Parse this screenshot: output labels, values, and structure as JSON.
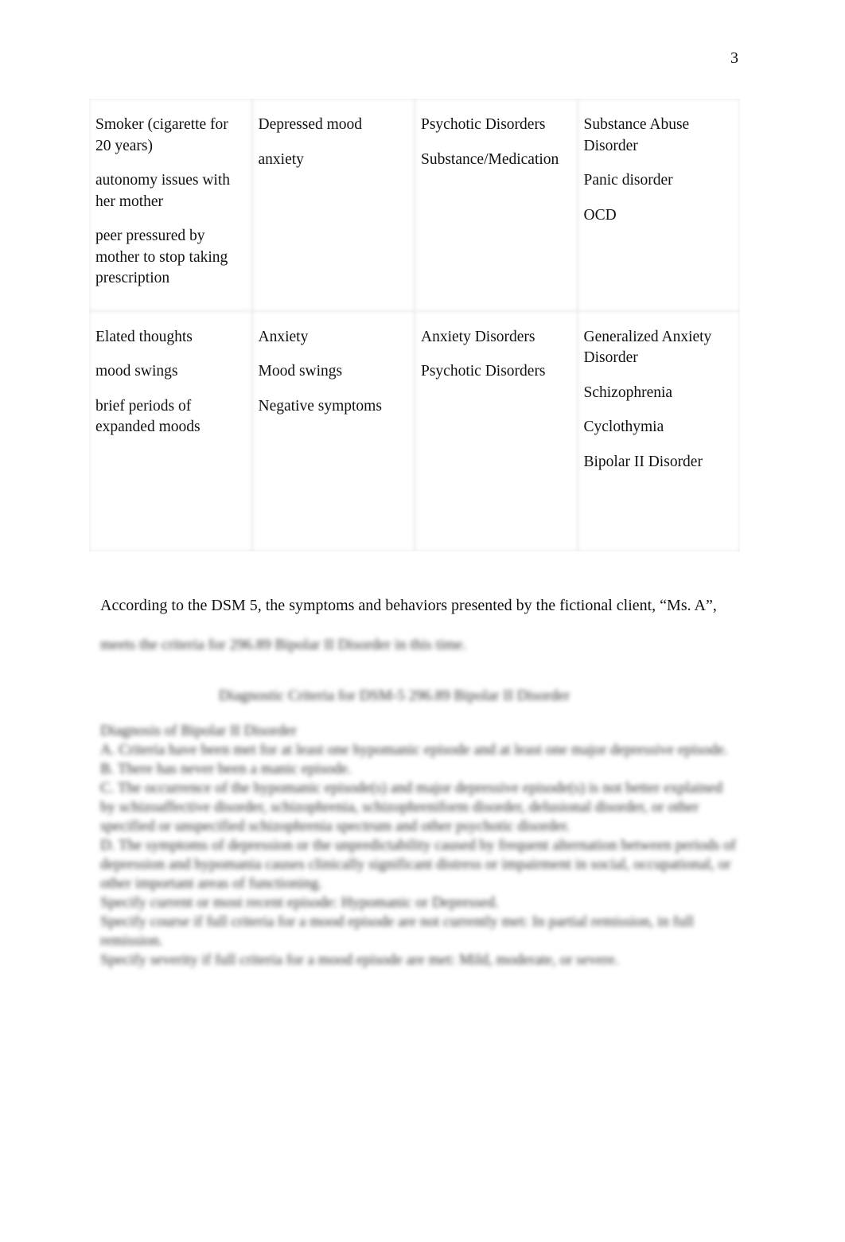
{
  "page_number": "3",
  "table": {
    "rows": [
      {
        "cells": [
          [
            "Smoker (cigarette for 20 years)",
            "autonomy issues with her mother",
            "peer pressured by mother to stop taking prescription"
          ],
          [
            "Depressed mood",
            "anxiety"
          ],
          [
            "Psychotic Disorders",
            "Substance/Medication"
          ],
          [
            "Substance Abuse Disorder",
            "Panic disorder",
            "OCD"
          ]
        ]
      },
      {
        "cells": [
          [
            "Elated thoughts",
            "mood swings",
            "brief periods of expanded moods"
          ],
          [
            "Anxiety",
            "Mood swings",
            "Negative symptoms"
          ],
          [
            "Anxiety Disorders",
            "Psychotic Disorders"
          ],
          [
            "Generalized Anxiety Disorder",
            "Schizophrenia",
            "Cyclothymia",
            "Bipolar II Disorder"
          ]
        ]
      }
    ]
  },
  "intro_text": "According to the DSM 5, the symptoms and behaviors presented by the fictional client, “Ms. A”,",
  "blurred": {
    "line2": "meets the criteria for 296.89 Bipolar II Disorder in this time.",
    "criteria_title": "Diagnostic Criteria for DSM-5 296.89 Bipolar II Disorder",
    "criteria_lines": [
      "Diagnosis of Bipolar II Disorder",
      "A. Criteria have been met for at least one hypomanic episode and at least one major depressive episode.",
      "B. There has never been a manic episode.",
      "C. The occurrence of the hypomanic episode(s) and major depressive episode(s) is not better explained by schizoaffective disorder, schizophrenia, schizophreniform disorder, delusional disorder, or other specified or unspecified schizophrenia spectrum and other psychotic disorder.",
      "D. The symptoms of depression or the unpredictability caused by frequent alternation between periods of depression and hypomania causes clinically significant distress or impairment in social, occupational, or other important areas of functioning.",
      "Specify current or most recent episode: Hypomanic or Depressed.",
      "Specify course if full criteria for a mood episode are not currently met: In partial remission, in full remission.",
      "Specify severity if full criteria for a mood episode are met: Mild, moderate, or severe."
    ]
  }
}
